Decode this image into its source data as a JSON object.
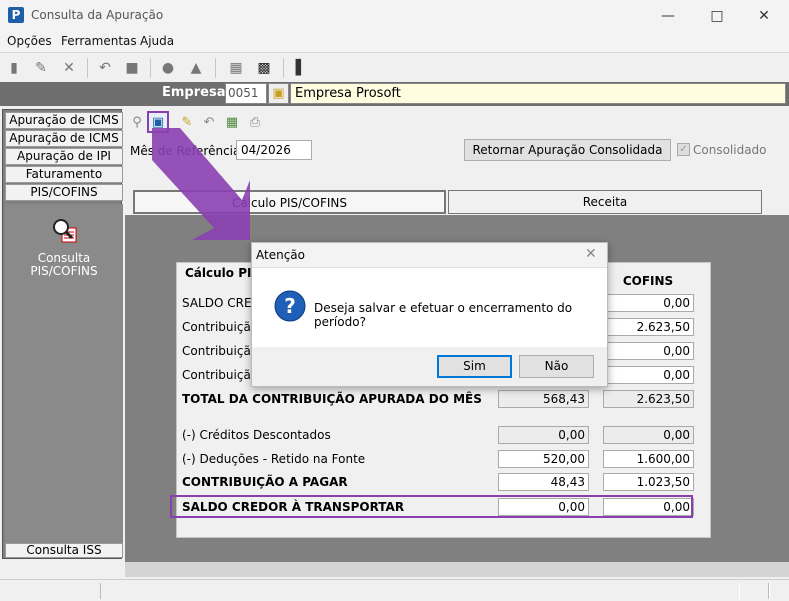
{
  "window": {
    "title": "Consulta da Apuração"
  },
  "menu": [
    "Opções",
    "Ferramentas",
    "Ajuda"
  ],
  "empresa": {
    "label": "Empresa",
    "code": "0051",
    "name": "Empresa Prosoft"
  },
  "sidebar": {
    "items": [
      {
        "label": "Apuração de ICMS"
      },
      {
        "label": "Apuração de ICMS ST"
      },
      {
        "label": "Apuração de IPI"
      },
      {
        "label": "Faturamento"
      },
      {
        "label": "PIS/COFINS"
      }
    ],
    "consulta_label": "Consulta PIS/COFINS",
    "bottom_item": "Consulta ISS"
  },
  "main": {
    "mes_label": "Mês de Referência:",
    "mes_value": "04/2026",
    "retornar_button": "Retornar Apuração Consolidada",
    "consolidado_label": "Consolidado",
    "tabs": [
      {
        "label": "Cálculo PIS/COFINS"
      },
      {
        "label": "Receita"
      }
    ],
    "calc": {
      "title": "Cálculo PIS/COFINS",
      "cofins_header": "COFINS",
      "rows": [
        {
          "label": "SALDO CREDOR",
          "pis": "",
          "cofins": "0,00"
        },
        {
          "label": "Contribuição A",
          "pis": "",
          "cofins": "2.623,50"
        },
        {
          "label": "Contribuição A",
          "pis": "",
          "cofins": "0,00"
        },
        {
          "label": "Contribuição A",
          "pis": "",
          "cofins": "0,00"
        },
        {
          "label": "TOTAL DA CONTRIBUIÇÃO APURADA DO MÊS",
          "pis": "568,43",
          "cofins": "2.623,50"
        },
        {
          "label": "(-) Créditos Descontados",
          "pis": "0,00",
          "cofins": "0,00"
        },
        {
          "label": "(-) Deduções - Retido na Fonte",
          "pis": "520,00",
          "cofins": "1.600,00"
        },
        {
          "label": "CONTRIBUIÇÃO A PAGAR",
          "pis": "48,43",
          "cofins": "1.023,50"
        },
        {
          "label": "SALDO CREDOR À TRANSPORTAR",
          "pis": "0,00",
          "cofins": "0,00"
        }
      ]
    }
  },
  "dialog": {
    "title": "Atenção",
    "message": "Deseja salvar e efetuar o encerramento do período?",
    "yes": "Sim",
    "no": "Não"
  },
  "colors": {
    "highlight": "#8a3fb0",
    "empresa_bar": "#6e6e6e",
    "panel_gray": "#808080"
  }
}
